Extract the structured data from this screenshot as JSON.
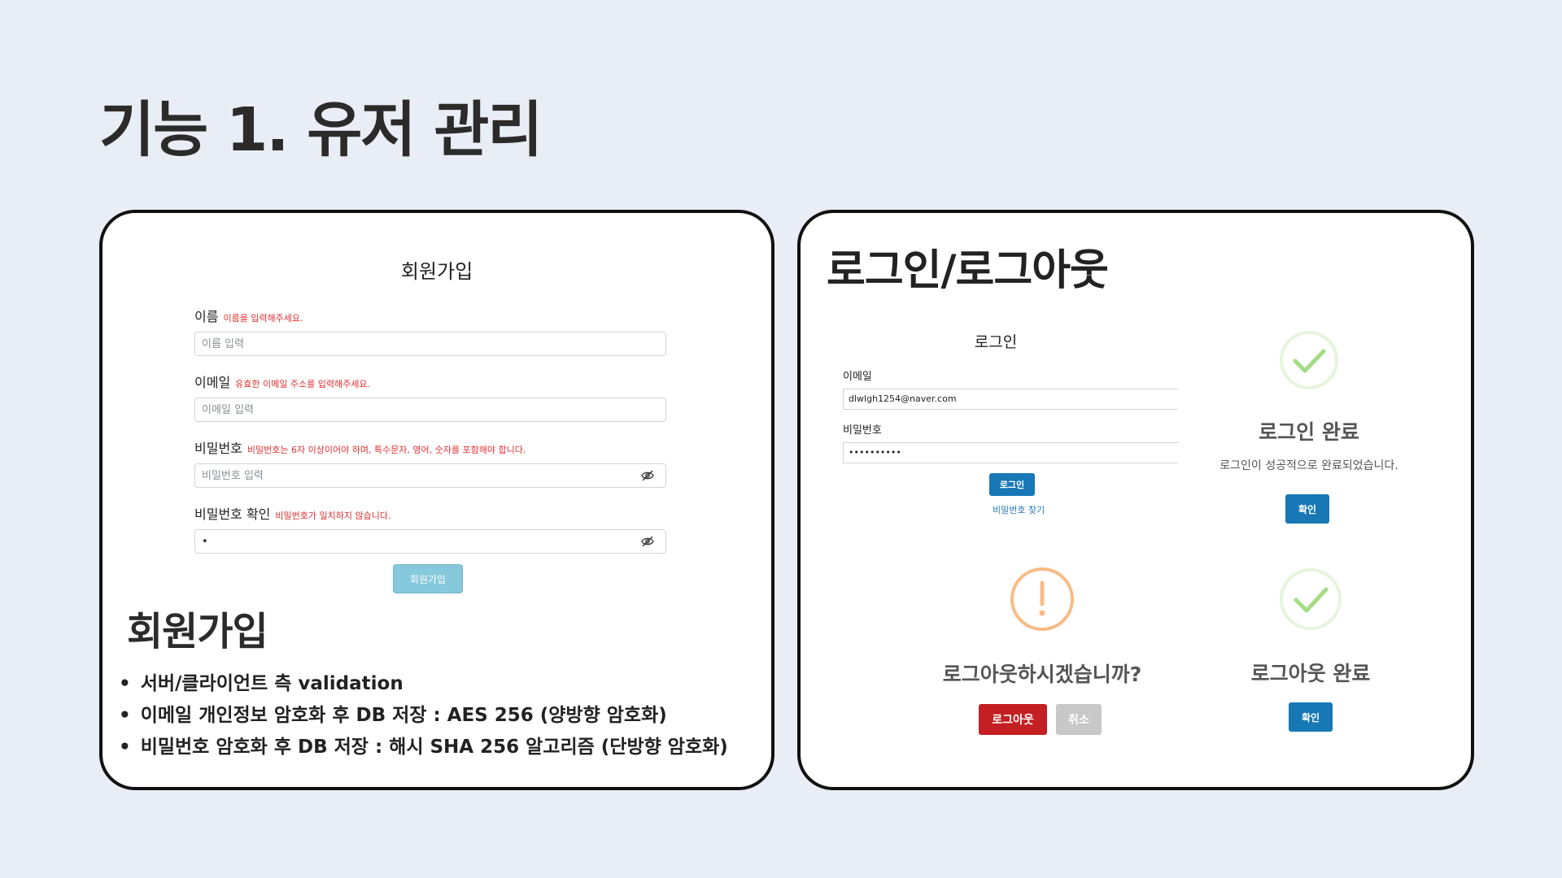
{
  "page_title": "기능 1. 유저 관리",
  "signup_form": {
    "title": "회원가입",
    "fields": [
      {
        "label": "이름",
        "error": "이름을 입력해주세요.",
        "placeholder": "이름 입력",
        "value": ""
      },
      {
        "label": "이메일",
        "error": "유효한 이메일 주소를 입력해주세요.",
        "placeholder": "이메일 입력",
        "value": ""
      },
      {
        "label": "비밀번호",
        "error": "비밀번호는 6자 이상이어야 하며, 특수문자, 영어, 숫자를 포함해야 합니다.",
        "placeholder": "비밀번호 입력",
        "value": ""
      },
      {
        "label": "비밀번호 확인",
        "error": "비밀번호가 일치하지 않습니다.",
        "placeholder": "",
        "value": "•"
      }
    ],
    "submit_label": "회원가입"
  },
  "signup_section": {
    "heading": "회원가입",
    "bullets": [
      "서버/클라이언트 측 validation",
      "이메일 개인정보 암호화 후 DB 저장 : AES 256 (양방향 암호화)",
      "비밀번호 암호화 후 DB 저장 : 해시 SHA 256 알고리즘 (단방향 암호화)"
    ]
  },
  "login_section": {
    "heading": "로그인/로그아웃",
    "login_form": {
      "title": "로그인",
      "email_label": "이메일",
      "email_value": "dlwlgh1254@naver.com",
      "password_label": "비밀번호",
      "password_value": "••••••••••",
      "login_button": "로그인",
      "find_password_link": "비밀번호 찾기"
    },
    "login_complete": {
      "title": "로그인 완료",
      "message": "로그인이 성공적으로 완료되었습니다.",
      "confirm_button": "확인"
    },
    "logout_confirm": {
      "title": "로그아웃하시겠습니까?",
      "logout_button": "로그아웃",
      "cancel_button": "취소"
    },
    "logout_complete": {
      "title": "로그아웃 완료",
      "confirm_button": "확인"
    }
  },
  "icons": {
    "success": "check-circle-icon",
    "warning": "exclamation-circle-icon",
    "password_toggle": "eye-slash-icon"
  },
  "colors": {
    "background": "#e9eef6",
    "success_green": "#a5dc86",
    "warning_orange": "#f8bb86",
    "primary_blue": "#1878b6",
    "danger_red": "#c41f22",
    "error_text": "#e03030",
    "signup_button": "#86c8dc"
  }
}
